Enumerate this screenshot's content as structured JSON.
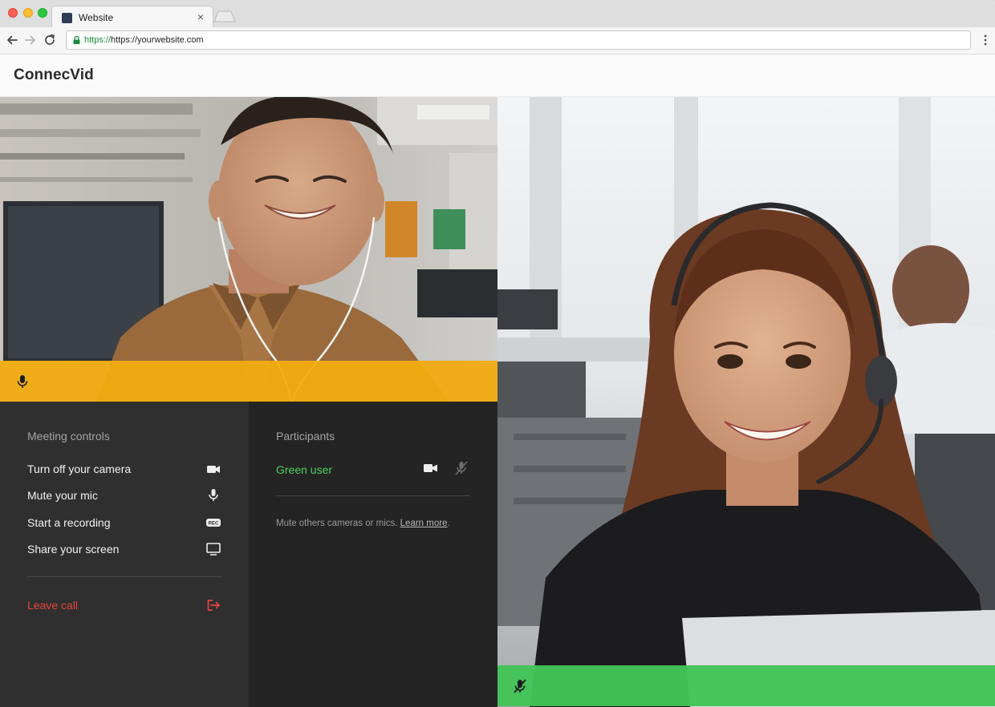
{
  "browser": {
    "tab_title": "Website",
    "tab_close": "×",
    "url_scheme": "https://",
    "url_host": "https://yourwebsite.com"
  },
  "app": {
    "brand": "ConnecVid"
  },
  "tiles": {
    "left": {
      "bar_color": "#f2ab0e",
      "status_icon": "mic-icon"
    },
    "right": {
      "bar_color": "#42c456",
      "status_icon": "mic-off-icon"
    }
  },
  "controls": {
    "heading": "Meeting controls",
    "items": [
      {
        "label": "Turn off your camera",
        "icon": "video-camera-icon"
      },
      {
        "label": "Mute your mic",
        "icon": "mic-icon"
      },
      {
        "label": "Start a recording",
        "icon": "rec-icon",
        "badge": "REC"
      },
      {
        "label": "Share your screen",
        "icon": "monitor-icon"
      }
    ],
    "leave": {
      "label": "Leave call",
      "icon": "exit-icon",
      "color": "#e8443a"
    }
  },
  "participants": {
    "heading": "Participants",
    "list": [
      {
        "name": "Green user",
        "color": "#4ccf5e",
        "camera_icon": "video-camera-icon",
        "mic_icon": "mic-off-icon"
      }
    ],
    "note": "Mute others cameras or mics. ",
    "note_link": "Learn more",
    "note_end": "."
  }
}
